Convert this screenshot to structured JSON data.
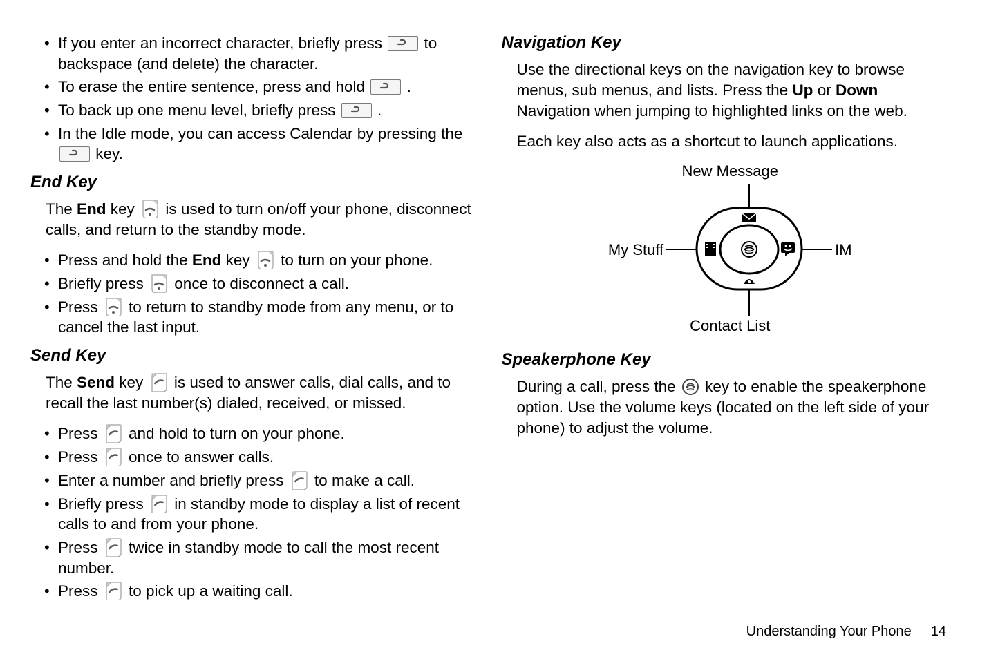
{
  "left": {
    "top_bullets": [
      {
        "pre": "If you enter an incorrect character, briefly press ",
        "icon": "back",
        "post": " to backspace (and delete) the character."
      },
      {
        "pre": "To erase the entire sentence, press and hold ",
        "icon": "back",
        "post": "."
      },
      {
        "pre": "To back up one menu level, briefly press ",
        "icon": "back",
        "post": "."
      },
      {
        "pre": "In the Idle mode, you can access Calendar by pressing the ",
        "icon": "back",
        "post": " key."
      }
    ],
    "end_key": {
      "heading": "End Key",
      "intro_pre": "The ",
      "intro_bold": "End",
      "intro_mid": " key ",
      "intro_post": " is used to turn on/off your phone, disconnect calls, and return to the standby mode.",
      "bullets": [
        {
          "pre": "Press and hold the ",
          "bold": "End",
          "mid": " key ",
          "icon": "end",
          "post": " to turn on your phone."
        },
        {
          "pre": "Briefly press ",
          "icon": "end",
          "post": " once to disconnect a call."
        },
        {
          "pre": "Press ",
          "icon": "end",
          "post": " to return to standby mode from any menu, or to cancel the last input."
        }
      ]
    },
    "send_key": {
      "heading": "Send Key",
      "intro_pre": "The ",
      "intro_bold": "Send",
      "intro_mid": " key ",
      "intro_post": " is used to answer calls, dial calls, and to recall the last number(s) dialed, received, or missed.",
      "bullets": [
        {
          "pre": "Press ",
          "icon": "send",
          "post": " and hold to turn on your phone."
        },
        {
          "pre": "Press ",
          "icon": "send",
          "post": " once to answer calls."
        },
        {
          "pre": "Enter a number and briefly press ",
          "icon": "send",
          "post": " to make a call."
        },
        {
          "pre": "Briefly press ",
          "icon": "send",
          "post": " in standby mode to display a list of recent calls to and from your phone."
        },
        {
          "pre": "Press ",
          "icon": "send",
          "post": " twice in standby mode to call the most recent number."
        },
        {
          "pre": "Press ",
          "icon": "send",
          "post": " to pick up a waiting call."
        }
      ]
    }
  },
  "right": {
    "nav_key": {
      "heading": "Navigation Key",
      "para1_pre": "Use the directional keys on the navigation key to browse menus, sub menus, and lists. Press the ",
      "para1_b1": "Up",
      "para1_mid": " or ",
      "para1_b2": "Down",
      "para1_post": " Navigation when jumping to highlighted links on the web.",
      "para2": "Each key also acts as a shortcut to launch applications.",
      "labels": {
        "top": "New Message",
        "left": "My Stuff",
        "right": "IM",
        "bottom": "Contact List"
      }
    },
    "speaker": {
      "heading": "Speakerphone Key",
      "para_pre": "During a call, press the ",
      "para_post": " key to enable the speakerphone option. Use the volume keys (located on the left side of your phone) to adjust the volume."
    }
  },
  "footer": {
    "section": "Understanding Your Phone",
    "page": "14"
  }
}
